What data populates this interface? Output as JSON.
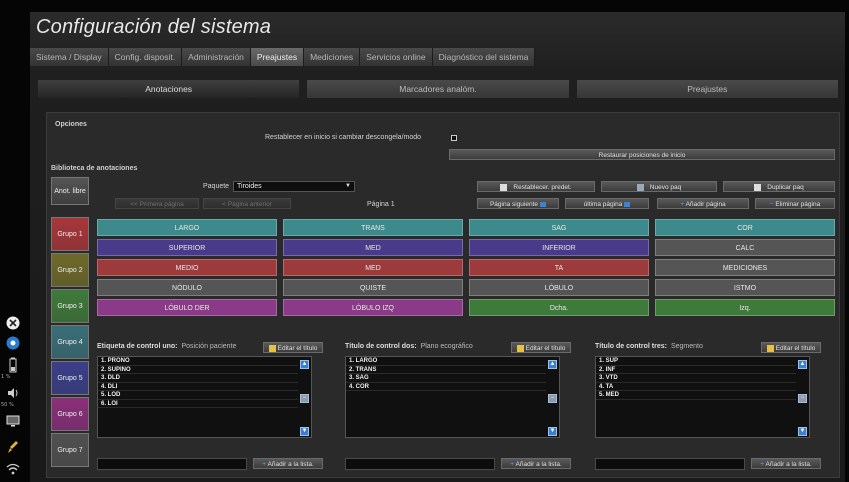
{
  "window": {
    "title": "Configuración del sistema"
  },
  "tabs": [
    {
      "label": "Sistema / Display",
      "active": false
    },
    {
      "label": "Config. disposit.",
      "active": false
    },
    {
      "label": "Administración",
      "active": false
    },
    {
      "label": "Preajustes",
      "active": true
    },
    {
      "label": "Mediciones",
      "active": false
    },
    {
      "label": "Servicios online",
      "active": false
    },
    {
      "label": "Diagnóstico del sistema",
      "active": false
    }
  ],
  "subtabs": [
    {
      "label": "Anotaciones",
      "active": true
    },
    {
      "label": "Marcadores analóm.",
      "active": false
    },
    {
      "label": "Preajustes",
      "active": false
    }
  ],
  "options": {
    "section_label": "Opciones",
    "restore_on_unfreeze_label": "Restablecer en inicio si cambiar descongela/modo",
    "restore_positions_button": "Restaurar posiciones de inicio"
  },
  "library": {
    "section_label": "Biblioteca de anotaciones",
    "free_annot_button": "Anot. libre",
    "package_label": "Paquete",
    "package_value": "Tiroides",
    "first_page_button": "<< Primera página",
    "prev_page_button": "< Página anterior",
    "page_indicator": "Página 1",
    "restore_defaults_button": "Restablecer. predet.",
    "new_package_button": "Nuevo paq",
    "duplicate_package_button": "Duplicar paq",
    "next_page_button": "Página siguiente",
    "last_page_button": "última página",
    "add_page_button": "Añadir página",
    "delete_page_button": "Eliminar página"
  },
  "groups": [
    {
      "label": "Grupo 1",
      "color": "#a8363a"
    },
    {
      "label": "Grupo 2",
      "color": "#6e6a2a"
    },
    {
      "label": "Grupo 3",
      "color": "#3f7a3a"
    },
    {
      "label": "Grupo 4",
      "color": "#3a6f78"
    },
    {
      "label": "Grupo 5",
      "color": "#3a3f8a"
    },
    {
      "label": "Grupo 6",
      "color": "#8a2f7a"
    },
    {
      "label": "Grupo 7",
      "color": "#505050"
    }
  ],
  "annotation_grid": [
    [
      {
        "label": "LARGO",
        "color": "#3d8a8c"
      },
      {
        "label": "TRANS",
        "color": "#3d8a8c"
      },
      {
        "label": "SAG",
        "color": "#3d8a8c"
      },
      {
        "label": "COR",
        "color": "#3d8a8c"
      }
    ],
    [
      {
        "label": "SUPERIOR",
        "color": "#4a3a8a"
      },
      {
        "label": "MED",
        "color": "#4a3a8a"
      },
      {
        "label": "INFERIOR",
        "color": "#4a3a8a"
      },
      {
        "label": "CALC",
        "color": "#555555"
      }
    ],
    [
      {
        "label": "MEDIO",
        "color": "#9c3a3c"
      },
      {
        "label": "MED",
        "color": "#9c3a3c"
      },
      {
        "label": "TA",
        "color": "#9c3a3c"
      },
      {
        "label": "MEDICIONES",
        "color": "#555555"
      }
    ],
    [
      {
        "label": "NÓDULO",
        "color": "#555555"
      },
      {
        "label": "QUISTE",
        "color": "#555555"
      },
      {
        "label": "LÓBULO",
        "color": "#555555"
      },
      {
        "label": "ISTMO",
        "color": "#555555"
      }
    ],
    [
      {
        "label": "LÓBULO DER",
        "color": "#8a3a86"
      },
      {
        "label": "LÓBULO IZQ",
        "color": "#8a3a86"
      },
      {
        "label": "Dcha.",
        "color": "#3e7a3a"
      },
      {
        "label": "Izq.",
        "color": "#3e7a3a"
      }
    ]
  ],
  "control_lists": [
    {
      "title": "Etiqueta de control uno:",
      "subtitle": "Posición paciente",
      "edit_button": "Editar el título",
      "items": [
        "1. PRONO",
        "2. SUPINO",
        "3. DLD",
        "4. DLI",
        "5. LOD",
        "6. LOI"
      ],
      "add_button": "Añadir a la lista."
    },
    {
      "title": "Título de control dos:",
      "subtitle": "Plano ecográfico",
      "edit_button": "Editar el título",
      "items": [
        "1. LARGO",
        "2. TRANS",
        "3. SAG",
        "4. COR"
      ],
      "add_button": "Añadir a la lista."
    },
    {
      "title": "Título de control tres:",
      "subtitle": "Segmento",
      "edit_button": "Editar el título",
      "items": [
        "1. SUP",
        "2. INF",
        "3. VTD",
        "4. TA",
        "5. MED"
      ],
      "add_button": "Añadir a la lista."
    }
  ],
  "left_strip": {
    "icons": [
      "close-circle-icon",
      "trackball-icon",
      "battery-icon",
      "volume-icon",
      "display-icon",
      "brush-icon",
      "wifi-icon"
    ],
    "labels": [
      "1 %",
      "50 %"
    ]
  }
}
